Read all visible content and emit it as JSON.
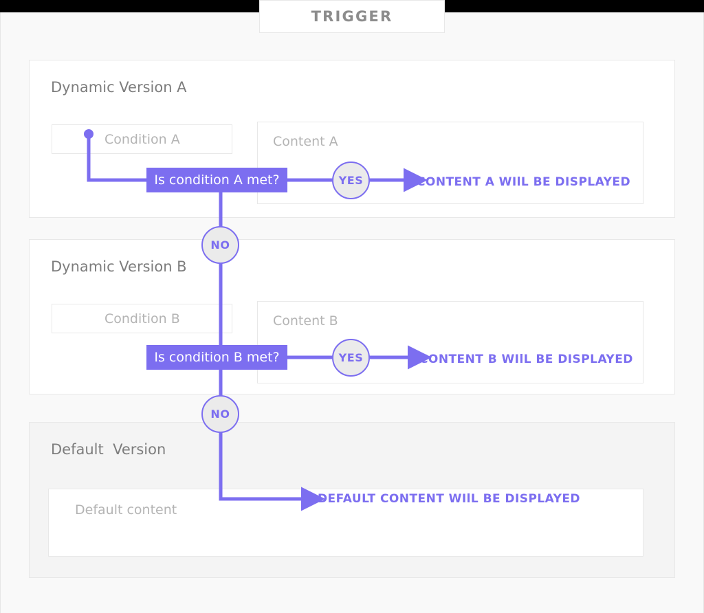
{
  "header": {
    "trigger_label": "TRIGGER"
  },
  "colors": {
    "accent_purple": "#7c6ef0",
    "node_fill": "#ebebeb",
    "panel_white": "#ffffff",
    "panel_grey": "#f4f4f4",
    "page_bg": "#f9f9f9",
    "placeholder_text": "#b4b4b4",
    "title_text": "#7d7d7d",
    "topbar": "#000000"
  },
  "sections": {
    "version_a": {
      "title": "Dynamic Version A",
      "condition_placeholder": "Condition A",
      "content_placeholder": "Content A",
      "decision_label": "Is condition A met?",
      "yes_label": "YES",
      "result_text": "CONTENT A WIlL BE DISPLAYED"
    },
    "version_b": {
      "title": "Dynamic Version B",
      "condition_placeholder": "Condition B",
      "content_placeholder": "Content B",
      "decision_label": "Is condition B met?",
      "yes_label": "YES",
      "result_text": "CONTENT B WIlL BE DISPLAYED"
    },
    "default_version": {
      "title": "Default  Version",
      "content_placeholder": "Default content",
      "result_text": "DEFAULT CONTENT WIlL BE DISPLAYED"
    }
  },
  "flow": {
    "no_label_1": "NO",
    "no_label_2": "NO"
  }
}
